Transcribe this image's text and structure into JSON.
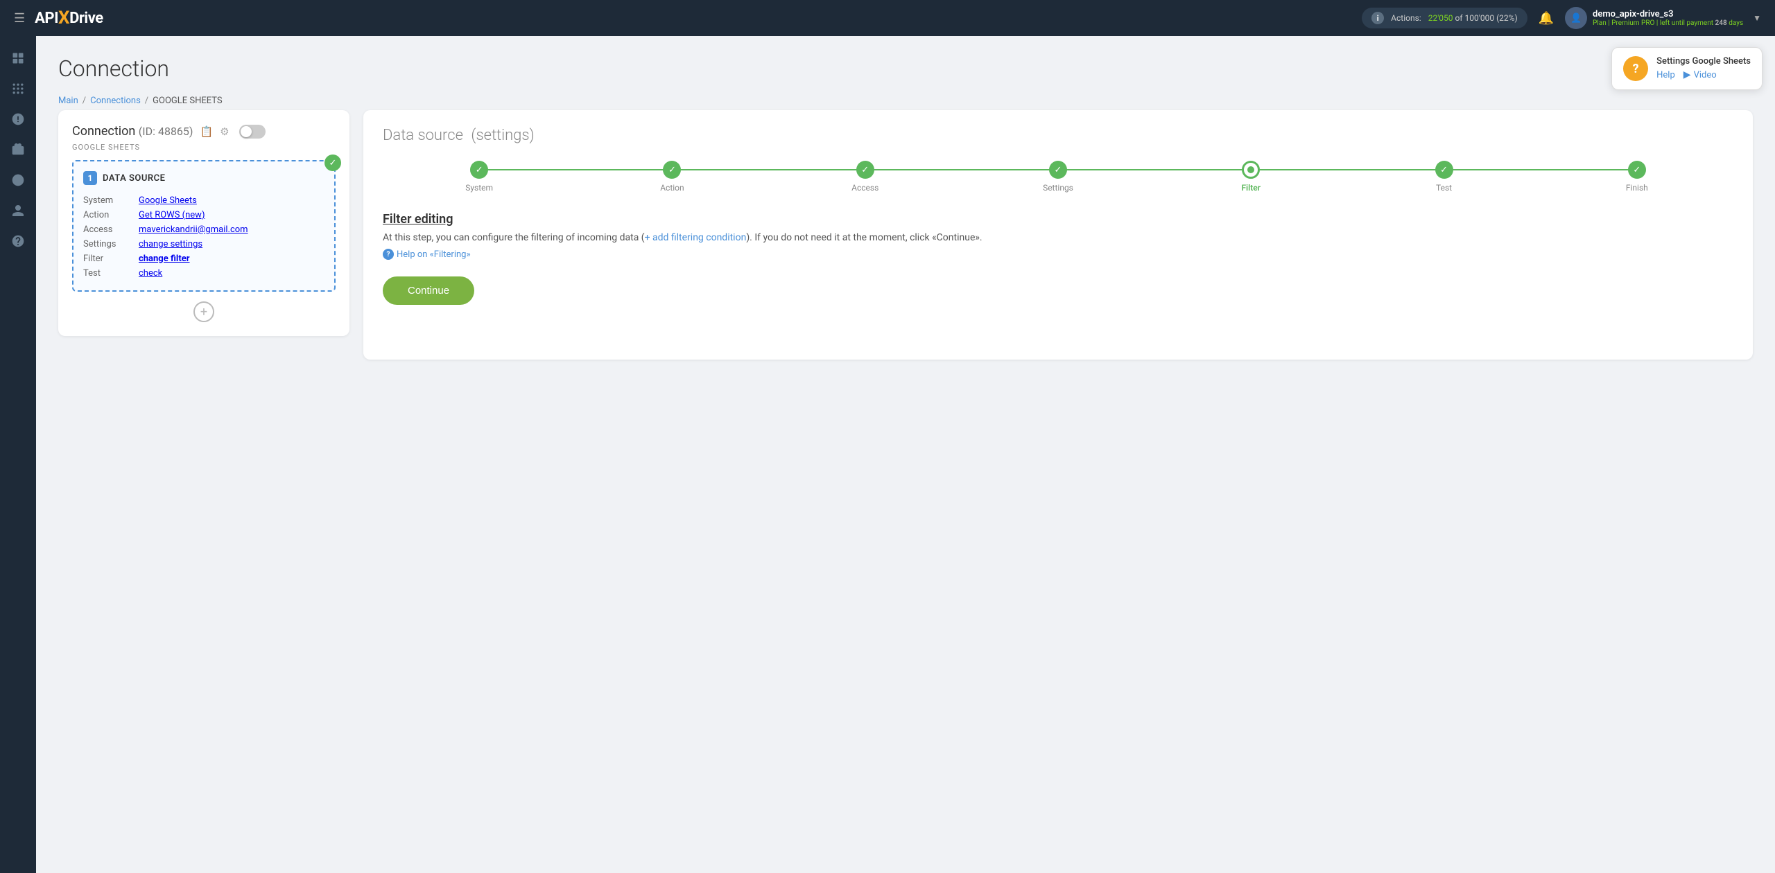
{
  "topnav": {
    "logo": {
      "api": "API",
      "x": "X",
      "drive": "Drive"
    },
    "actions": {
      "label": "Actions:",
      "count": "22'050",
      "of": "of",
      "total": "100'000",
      "percent": "(22%)"
    },
    "user": {
      "name": "demo_apix-drive_s3",
      "plan_label": "Plan |",
      "plan_name": "Premium PRO",
      "plan_pipe": "|",
      "plan_left": "left until payment",
      "plan_days": "248",
      "plan_days_label": "days"
    }
  },
  "help_tooltip": {
    "title": "Settings Google Sheets",
    "help_label": "Help",
    "video_label": "Video"
  },
  "sidebar": {
    "items": [
      {
        "icon": "⊞",
        "name": "dashboard"
      },
      {
        "icon": "⋮⋮",
        "name": "connections"
      },
      {
        "icon": "$",
        "name": "billing"
      },
      {
        "icon": "💼",
        "name": "projects"
      },
      {
        "icon": "▶",
        "name": "youtube"
      },
      {
        "icon": "👤",
        "name": "profile"
      },
      {
        "icon": "?",
        "name": "help"
      }
    ]
  },
  "breadcrumb": {
    "main": "Main",
    "separator1": "/",
    "connections": "Connections",
    "separator2": "/",
    "current": "GOOGLE SHEETS"
  },
  "page_title": "Connection",
  "left_card": {
    "title": "Connection",
    "id_label": "(ID: 48865)",
    "source_label": "GOOGLE SHEETS",
    "datasource": {
      "number": "1",
      "title": "DATA SOURCE",
      "rows": [
        {
          "label": "System",
          "value": "Google Sheets",
          "is_link": true,
          "bold": false
        },
        {
          "label": "Action",
          "value": "Get ROWS (new)",
          "is_link": true,
          "bold": false
        },
        {
          "label": "Access",
          "value": "maverickandrii@gmail.com",
          "is_link": true,
          "bold": false
        },
        {
          "label": "Settings",
          "value": "change settings",
          "is_link": true,
          "bold": false
        },
        {
          "label": "Filter",
          "value": "change filter",
          "is_link": true,
          "bold": true
        },
        {
          "label": "Test",
          "value": "check",
          "is_link": true,
          "bold": false
        }
      ]
    },
    "add_btn": "+"
  },
  "right_card": {
    "title": "Data source",
    "title_sub": "(settings)",
    "stepper": {
      "steps": [
        {
          "label": "System",
          "completed": true,
          "active": false
        },
        {
          "label": "Action",
          "completed": true,
          "active": false
        },
        {
          "label": "Access",
          "completed": true,
          "active": false
        },
        {
          "label": "Settings",
          "completed": true,
          "active": false
        },
        {
          "label": "Filter",
          "completed": false,
          "active": true
        },
        {
          "label": "Test",
          "completed": true,
          "active": false
        },
        {
          "label": "Finish",
          "completed": true,
          "active": false
        }
      ]
    },
    "filter": {
      "title": "Filter editing",
      "desc_before": "At this step, you can configure the filtering of incoming data (",
      "add_link": "+ add filtering condition",
      "desc_after": "). If you do not need it at the moment, click «Continue».",
      "help_text": "Help on «Filtering»"
    },
    "continue_btn": "Continue"
  }
}
